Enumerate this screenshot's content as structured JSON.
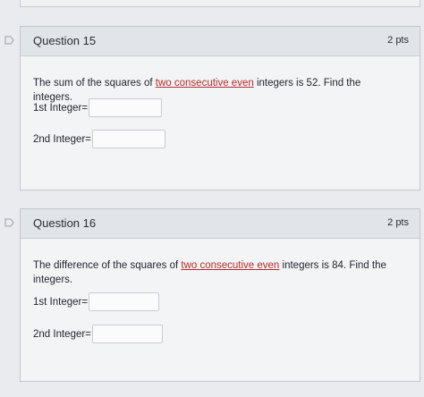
{
  "questions": [
    {
      "title": "Question 15",
      "points": "2 pts",
      "text_before": "The sum of the squares of ",
      "text_underlined": "two consecutive even",
      "text_after": " integers is 52. Find the integers.",
      "fields": [
        {
          "label": "1st Integer=",
          "value": ""
        },
        {
          "label": "2nd Integer=",
          "value": ""
        }
      ]
    },
    {
      "title": "Question 16",
      "points": "2 pts",
      "text_before": "The difference of the squares of ",
      "text_underlined": "two consecutive even",
      "text_after": " integers is 84. Find the integers.",
      "fields": [
        {
          "label": "1st Integer=",
          "value": ""
        },
        {
          "label": "2nd Integer=",
          "value": ""
        }
      ]
    }
  ],
  "icons": {
    "flag": "flag-icon"
  },
  "colors": {
    "underline_text": "#b52b2b",
    "header_bg": "#e1e4e8",
    "card_bg": "#f3f4f6"
  }
}
